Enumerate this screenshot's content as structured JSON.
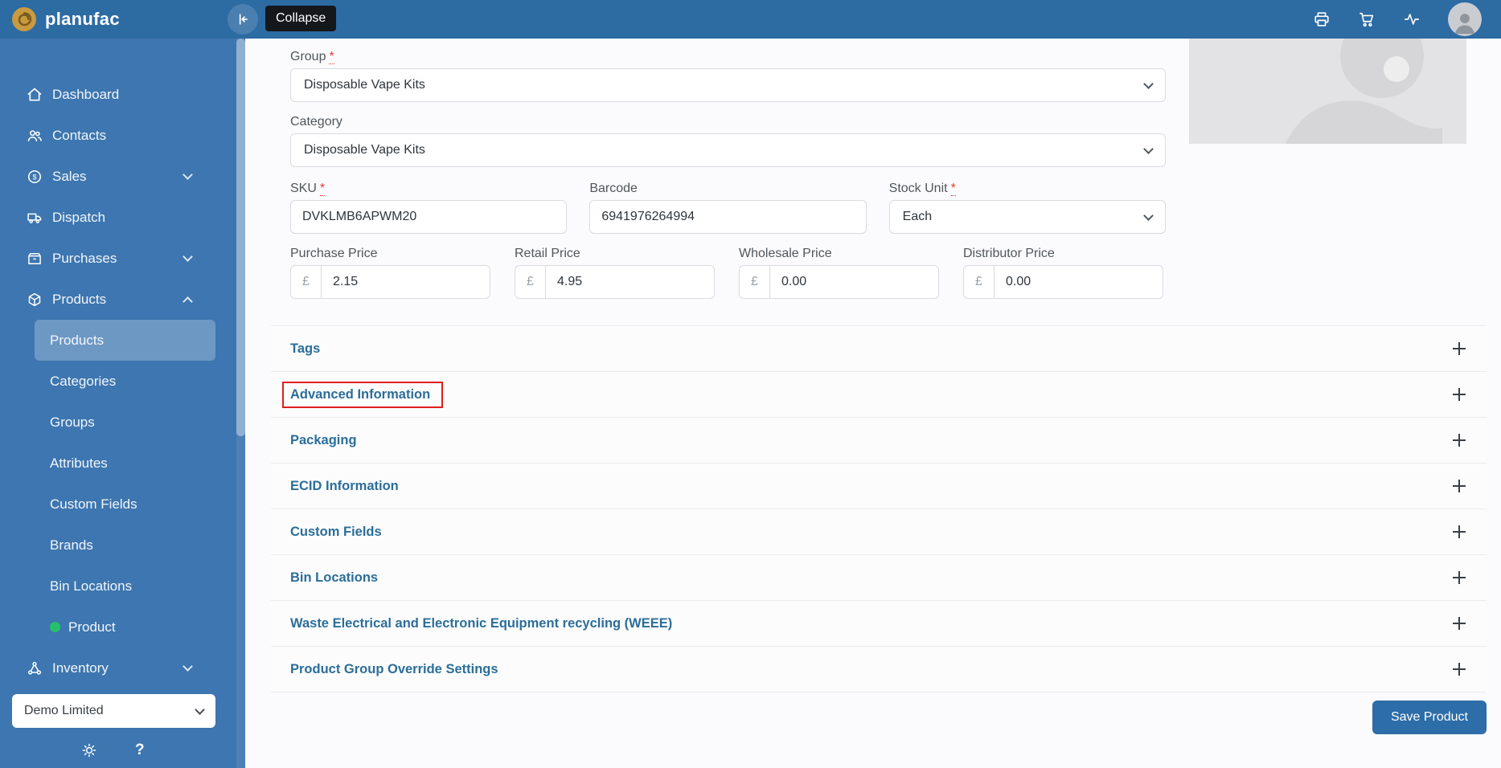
{
  "colors": {
    "topbar": "#2d6ba3",
    "sidebar": "#3d76b0",
    "accent_blue": "#2d6da8",
    "section_title_blue": "#2b6e99",
    "highlight_red": "#e01e1e",
    "product_dot_green": "#27c06a"
  },
  "topbar": {
    "brand": "planufac",
    "collapse_tooltip": "Collapse"
  },
  "sidebar": {
    "items": [
      {
        "label": "Dashboard",
        "icon": "home-icon"
      },
      {
        "label": "Contacts",
        "icon": "contacts-icon"
      },
      {
        "label": "Sales",
        "icon": "sales-icon",
        "chevron": "down"
      },
      {
        "label": "Dispatch",
        "icon": "dispatch-icon"
      },
      {
        "label": "Purchases",
        "icon": "purchases-icon",
        "chevron": "down"
      },
      {
        "label": "Products",
        "icon": "products-icon",
        "chevron": "up",
        "expanded": true
      }
    ],
    "products_submenu": [
      {
        "label": "Products",
        "active": true
      },
      {
        "label": "Categories"
      },
      {
        "label": "Groups"
      },
      {
        "label": "Attributes"
      },
      {
        "label": "Custom Fields"
      },
      {
        "label": "Brands"
      },
      {
        "label": "Bin Locations"
      },
      {
        "label": "Product",
        "dot": true
      }
    ],
    "items_after": [
      {
        "label": "Inventory",
        "icon": "inventory-icon",
        "chevron": "down"
      }
    ],
    "company_select": {
      "value": "Demo Limited"
    },
    "help_label": "?"
  },
  "form": {
    "required_mark": "*",
    "group": {
      "label": "Group",
      "required": true,
      "value": "Disposable Vape Kits"
    },
    "category": {
      "label": "Category",
      "value": "Disposable Vape Kits"
    },
    "sku": {
      "label": "SKU",
      "required": true,
      "value": "DVKLMB6APWM20"
    },
    "barcode": {
      "label": "Barcode",
      "value": "6941976264994"
    },
    "stock_unit": {
      "label": "Stock Unit",
      "required": true,
      "value": "Each"
    },
    "prices": [
      {
        "label": "Purchase Price",
        "currency": "£",
        "value": "2.15"
      },
      {
        "label": "Retail Price",
        "currency": "£",
        "value": "4.95"
      },
      {
        "label": "Wholesale Price",
        "currency": "£",
        "value": "0.00"
      },
      {
        "label": "Distributor Price",
        "currency": "£",
        "value": "0.00"
      }
    ]
  },
  "sections": [
    {
      "label": "Tags"
    },
    {
      "label": "Advanced Information",
      "highlighted": true
    },
    {
      "label": "Packaging"
    },
    {
      "label": "ECID Information"
    },
    {
      "label": "Custom Fields"
    },
    {
      "label": "Bin Locations"
    },
    {
      "label": "Waste Electrical and Electronic Equipment recycling (WEEE)"
    },
    {
      "label": "Product Group Override Settings"
    }
  ],
  "actions": {
    "save_label": "Save Product"
  }
}
